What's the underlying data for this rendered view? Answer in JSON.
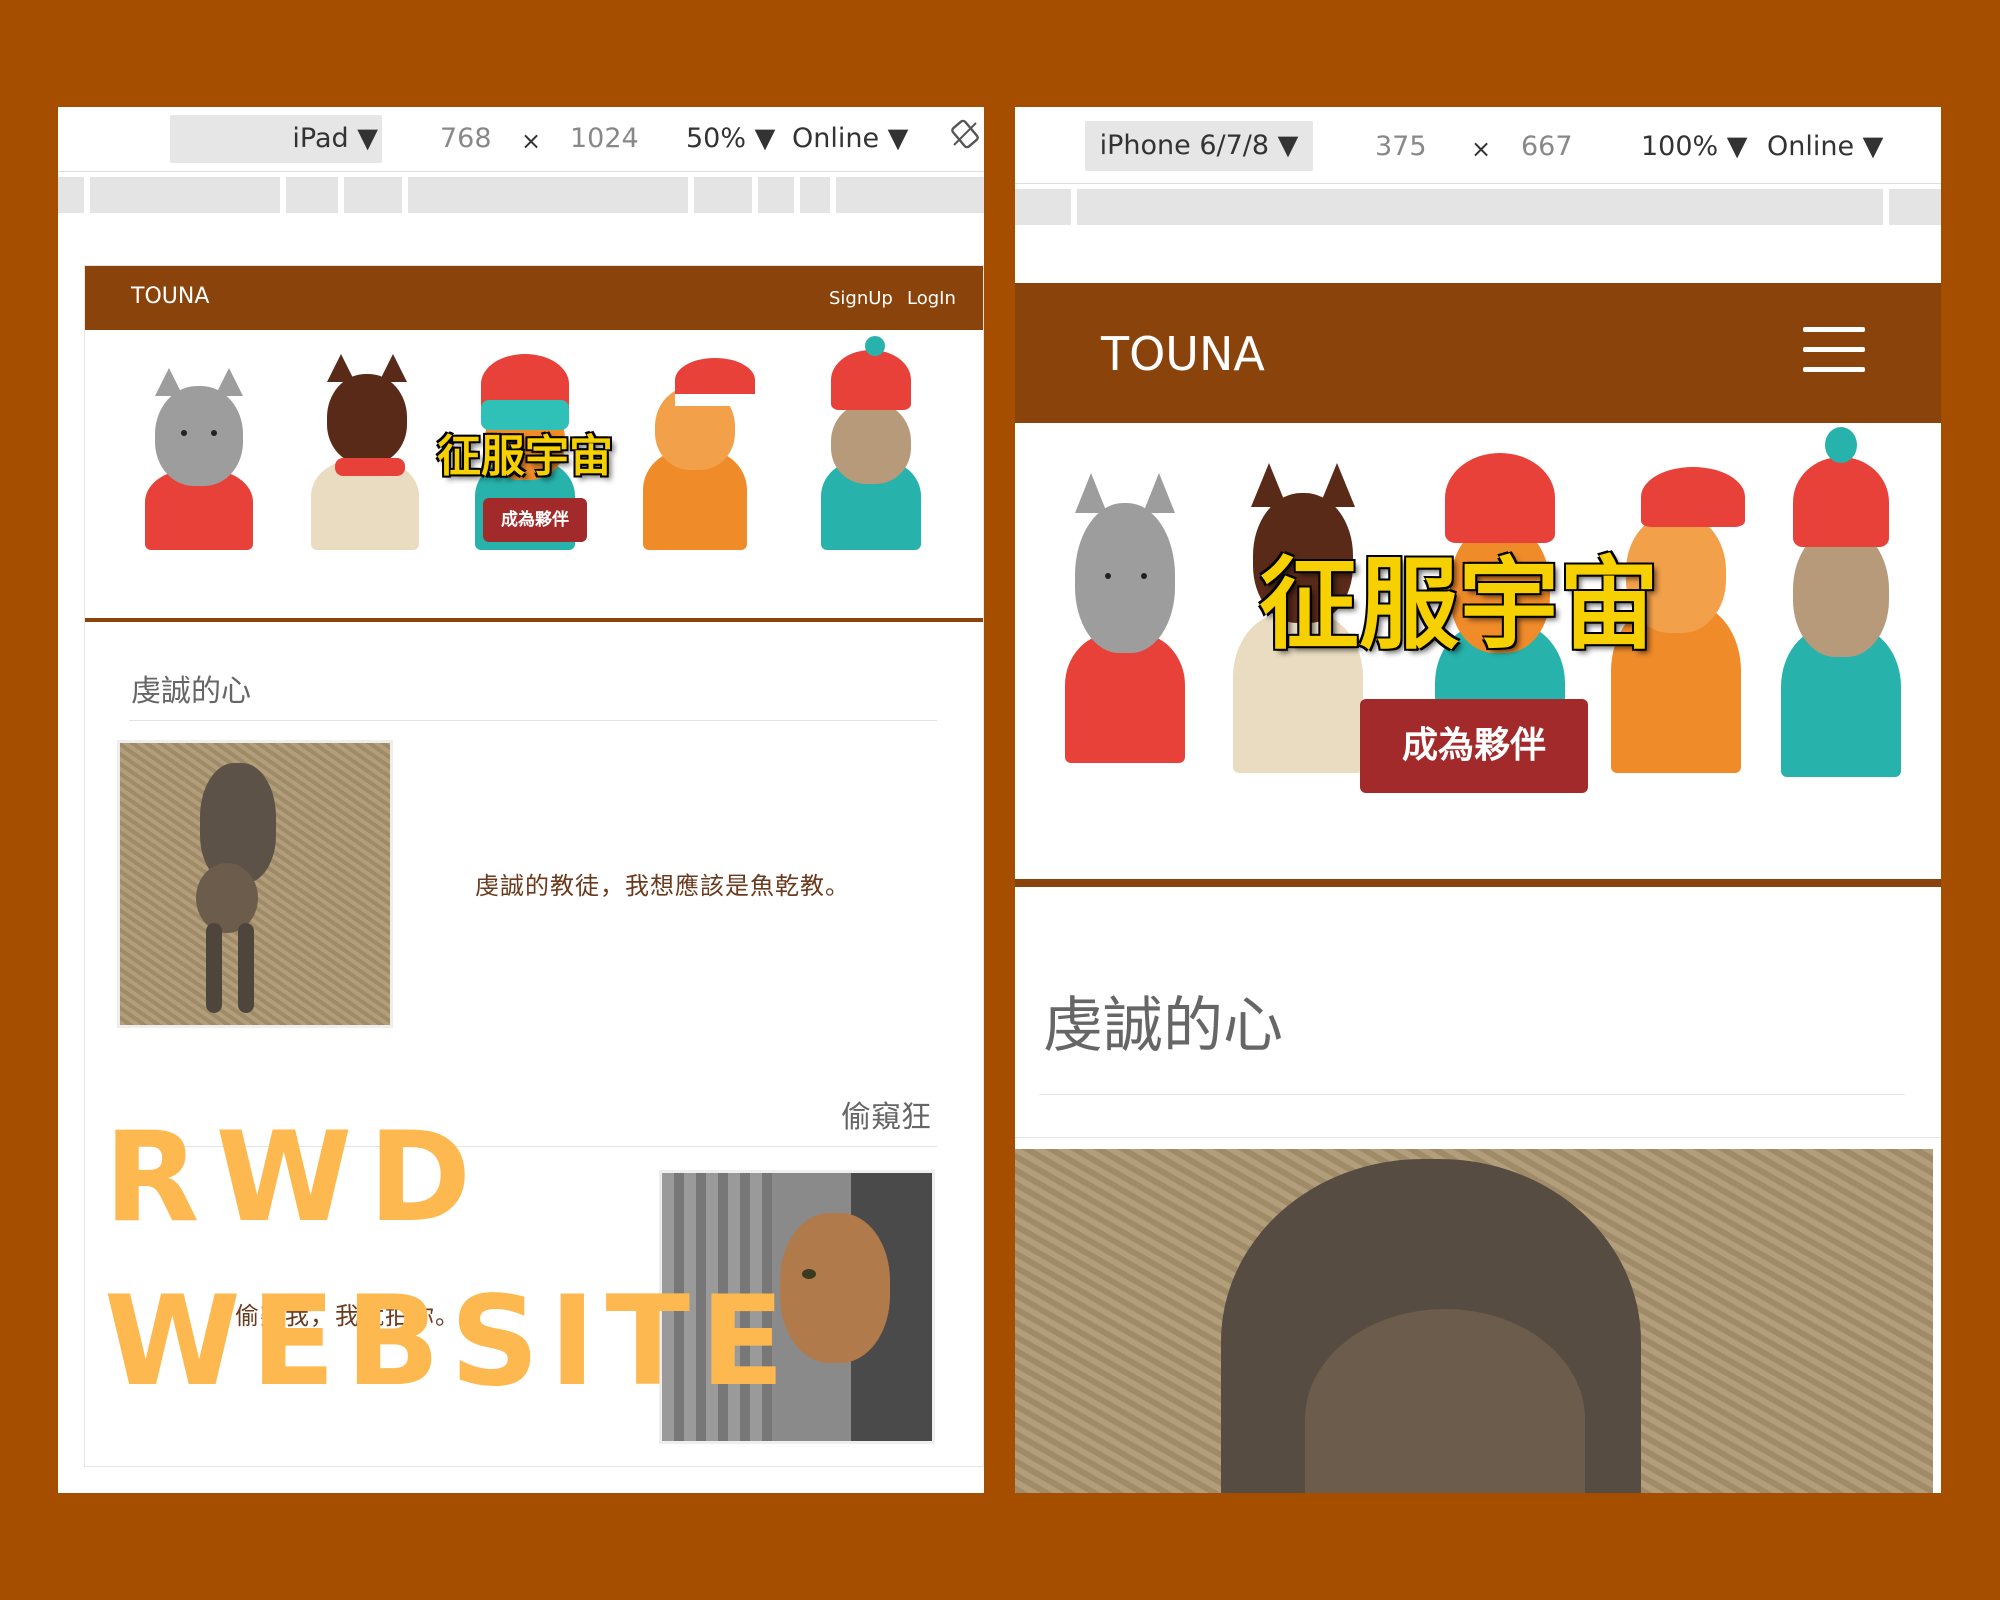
{
  "ipad": {
    "device": "iPad ▼",
    "width": "768",
    "times": "×",
    "height": "1024",
    "zoom": "50% ▼",
    "network": "Online ▼",
    "brand": "TOUNA",
    "signup": "SignUp",
    "login": "LogIn",
    "hero_title": "征服宇宙",
    "cta": "成為夥伴",
    "section1_title": "虔誠的心",
    "section1_caption": "虔誠的教徒，我想應該是魚乾教。",
    "section2_title": "偷窺狂",
    "section2_caption": "偷窺我，我就拍你。"
  },
  "iphone": {
    "device": "iPhone 6/7/8 ▼",
    "width": "375",
    "times": "×",
    "height": "667",
    "zoom": "100% ▼",
    "network": "Online ▼",
    "brand": "TOUNA",
    "hero_title": "征服宇宙",
    "cta": "成為夥伴",
    "section1_title": "虔誠的心"
  },
  "overlay": {
    "line1": "RWD",
    "line2": "WEBSITE"
  },
  "icons": {
    "rotate": "rotate-icon",
    "menu": "hamburger-menu-icon"
  },
  "colors": {
    "background": "#a64e00",
    "navbar": "#8b430c",
    "cta": "#a32a2a",
    "hero_text": "#f7d000",
    "overlay_text": "#fdb94f"
  }
}
